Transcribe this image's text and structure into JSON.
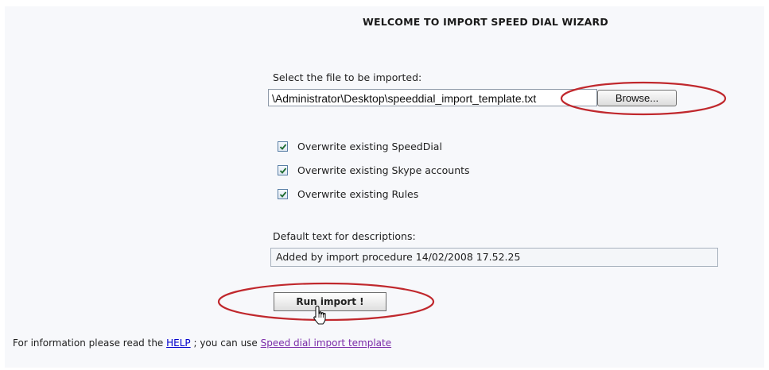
{
  "wizard": {
    "title": "WELCOME TO IMPORT SPEED DIAL WIZARD",
    "file_label": "Select the file to be imported:",
    "file_value": "\\Administrator\\Desktop\\speeddial_import_template.txt",
    "browse_label": "Browse...",
    "options": [
      {
        "label": "Overwrite existing SpeedDial",
        "checked": true
      },
      {
        "label": "Overwrite existing Skype accounts",
        "checked": true
      },
      {
        "label": "Overwrite existing Rules",
        "checked": true
      }
    ],
    "desc_label": "Default text for descriptions:",
    "desc_value": "Added by import procedure 14/02/2008 17.52.25",
    "run_label": "Run import !"
  },
  "footer": {
    "prefix": "For information please read the ",
    "help_link": "HELP",
    "middle": " ; you can use ",
    "template_link": "Speed dial import template"
  },
  "colors": {
    "annotation_ellipse": "#c0282d",
    "help_link": "#0000cc",
    "visited_link": "#7a2aa8"
  },
  "icons": {
    "checkbox": "checkmark-icon",
    "cursor": "hand-pointer-icon"
  }
}
